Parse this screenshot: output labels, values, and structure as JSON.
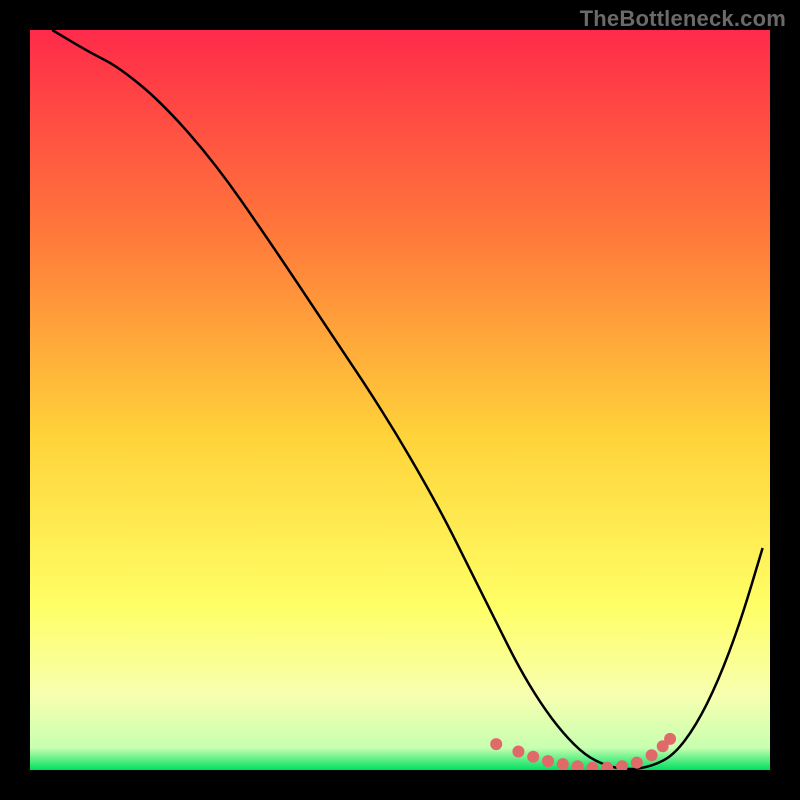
{
  "watermark": "TheBottleneck.com",
  "chart_data": {
    "type": "line",
    "title": "",
    "xlabel": "",
    "ylabel": "",
    "xlim": [
      0,
      100
    ],
    "ylim": [
      0,
      100
    ],
    "grid": false,
    "legend": false,
    "background_gradient": {
      "top": "#ff2a4a",
      "mid1": "#ff7a3a",
      "mid2": "#ffd33a",
      "mid3": "#ffff66",
      "mid4": "#f7ffb0",
      "bottom": "#00e060"
    },
    "series": [
      {
        "name": "curve",
        "stroke": "#000000",
        "x": [
          3,
          8,
          12,
          18,
          25,
          32,
          40,
          48,
          55,
          60,
          63,
          66,
          69,
          72,
          75,
          78,
          81,
          84,
          87,
          90,
          93,
          96,
          99
        ],
        "y": [
          100,
          97,
          95,
          90,
          82,
          72,
          60,
          48,
          36,
          26,
          20,
          14,
          9,
          5,
          2,
          0.5,
          0,
          0.5,
          2,
          6,
          12,
          20,
          30
        ]
      }
    ],
    "highlight_points": {
      "color": "#e06a6a",
      "radius": 6,
      "x": [
        63,
        66,
        68,
        70,
        72,
        74,
        76,
        78,
        80,
        82,
        84,
        85.5,
        86.5
      ],
      "y": [
        3.5,
        2.5,
        1.8,
        1.2,
        0.8,
        0.5,
        0.3,
        0.3,
        0.5,
        1.0,
        2.0,
        3.2,
        4.2
      ]
    }
  }
}
